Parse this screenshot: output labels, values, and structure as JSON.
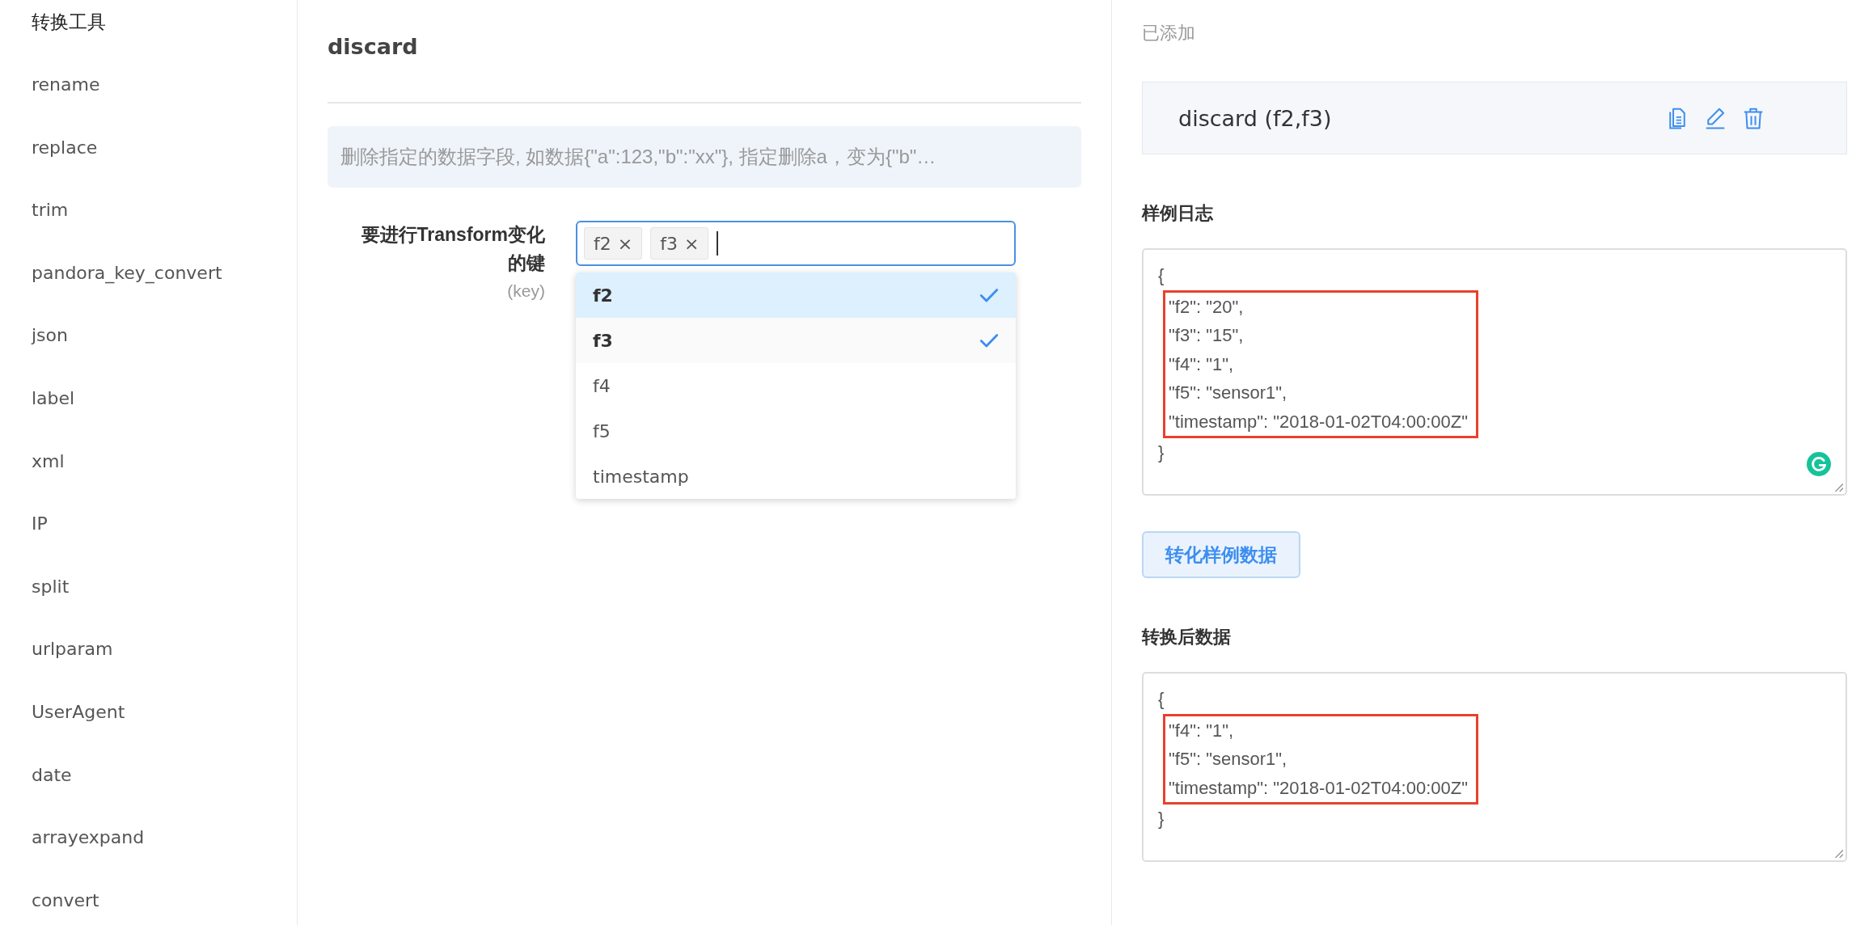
{
  "sidebar": {
    "heading": "转换工具",
    "items": [
      {
        "label": "rename"
      },
      {
        "label": "replace"
      },
      {
        "label": "trim"
      },
      {
        "label": "pandora_key_convert"
      },
      {
        "label": "json"
      },
      {
        "label": "label"
      },
      {
        "label": "xml"
      },
      {
        "label": "IP"
      },
      {
        "label": "split"
      },
      {
        "label": "urlparam"
      },
      {
        "label": "UserAgent"
      },
      {
        "label": "date"
      },
      {
        "label": "arrayexpand"
      },
      {
        "label": "convert"
      }
    ]
  },
  "editor": {
    "title": "discard",
    "description": "删除指定的数据字段, 如数据{\"a\":123,\"b\":\"xx\"}, 指定删除a，变为{\"b\"…",
    "field": {
      "label": "要进行Transform变化的键",
      "hint": "(key)",
      "tags": [
        {
          "label": "f2",
          "remove": "×"
        },
        {
          "label": "f3",
          "remove": "×"
        }
      ],
      "options": [
        {
          "label": "f2",
          "selected": true,
          "active": true
        },
        {
          "label": "f3",
          "selected": true,
          "active": false
        },
        {
          "label": "f4",
          "selected": false,
          "active": false
        },
        {
          "label": "f5",
          "selected": false,
          "active": false
        },
        {
          "label": "timestamp",
          "selected": false,
          "active": false
        }
      ]
    }
  },
  "added": {
    "heading": "已添加",
    "items": [
      {
        "label": "discard (f2,f3)"
      }
    ]
  },
  "sample": {
    "heading": "样例日志",
    "grammar_badge": true,
    "lines": [
      {
        "text": "{",
        "highlighted": false
      },
      {
        "text": "\"f2\": \"20\",",
        "highlighted": true
      },
      {
        "text": "\"f3\": \"15\",",
        "highlighted": true
      },
      {
        "text": "\"f4\": \"1\",",
        "highlighted": true
      },
      {
        "text": "\"f5\": \"sensor1\",",
        "highlighted": true
      },
      {
        "text": "\"timestamp\": \"2018-01-02T04:00:00Z\"",
        "highlighted": true
      },
      {
        "text": "}",
        "highlighted": false
      }
    ]
  },
  "convert_button": "转化样例数据",
  "result": {
    "heading": "转换后数据",
    "lines": [
      {
        "text": "{",
        "highlighted": false
      },
      {
        "text": "\"f4\": \"1\",",
        "highlighted": true
      },
      {
        "text": "\"f5\": \"sensor1\",",
        "highlighted": true
      },
      {
        "text": "\"timestamp\": \"2018-01-02T04:00:00Z\"",
        "highlighted": true
      },
      {
        "text": "}",
        "highlighted": false
      }
    ]
  }
}
